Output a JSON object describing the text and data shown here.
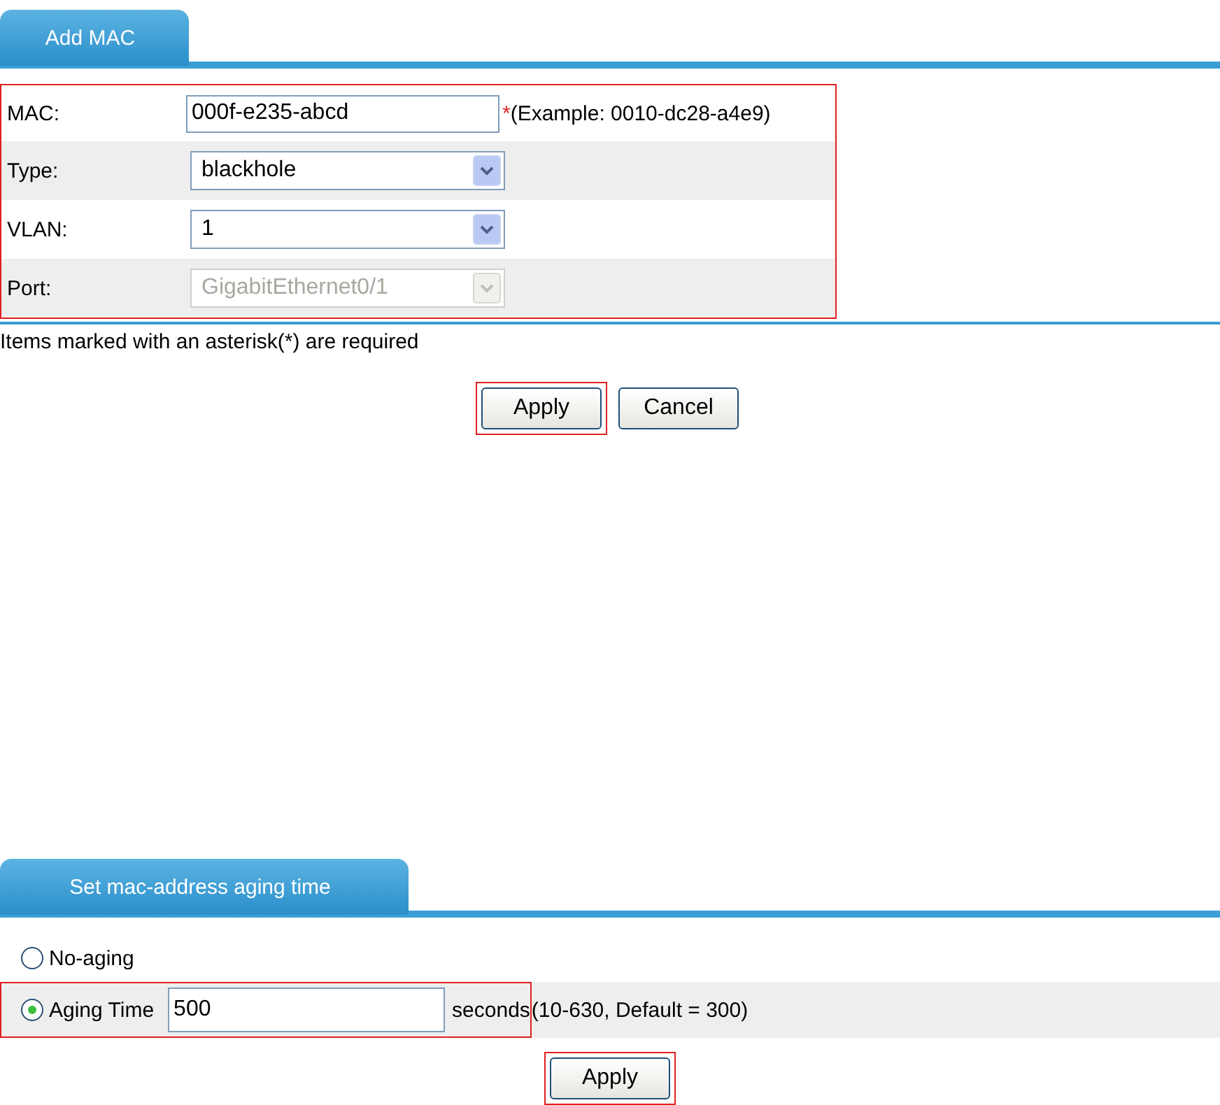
{
  "add_mac": {
    "tab": "Add MAC",
    "fields": [
      {
        "kind": "text",
        "label": "MAC:",
        "value": "000f-e235-abcd",
        "required_mark": "*",
        "hint": "(Example: 0010-dc28-a4e9)"
      },
      {
        "kind": "select",
        "label": "Type:",
        "value": "blackhole",
        "disabled": false
      },
      {
        "kind": "select",
        "label": "VLAN:",
        "value": "1",
        "disabled": false
      },
      {
        "kind": "select",
        "label": "Port:",
        "value": "GigabitEthernet0/1",
        "disabled": true
      }
    ],
    "note": "Items marked with an asterisk(*) are required",
    "buttons": [
      {
        "label": "Apply",
        "highlighted": true
      },
      {
        "label": "Cancel",
        "highlighted": false
      }
    ]
  },
  "aging": {
    "tab": "Set mac-address aging time",
    "options": [
      {
        "label": "No-aging",
        "selected": false,
        "highlighted": false
      },
      {
        "label": "Aging Time",
        "selected": true,
        "highlighted": true,
        "value": "500",
        "unit": "seconds",
        "hint": "(10-630, Default = 300)"
      }
    ],
    "buttons": [
      {
        "label": "Apply",
        "highlighted": true
      }
    ]
  }
}
